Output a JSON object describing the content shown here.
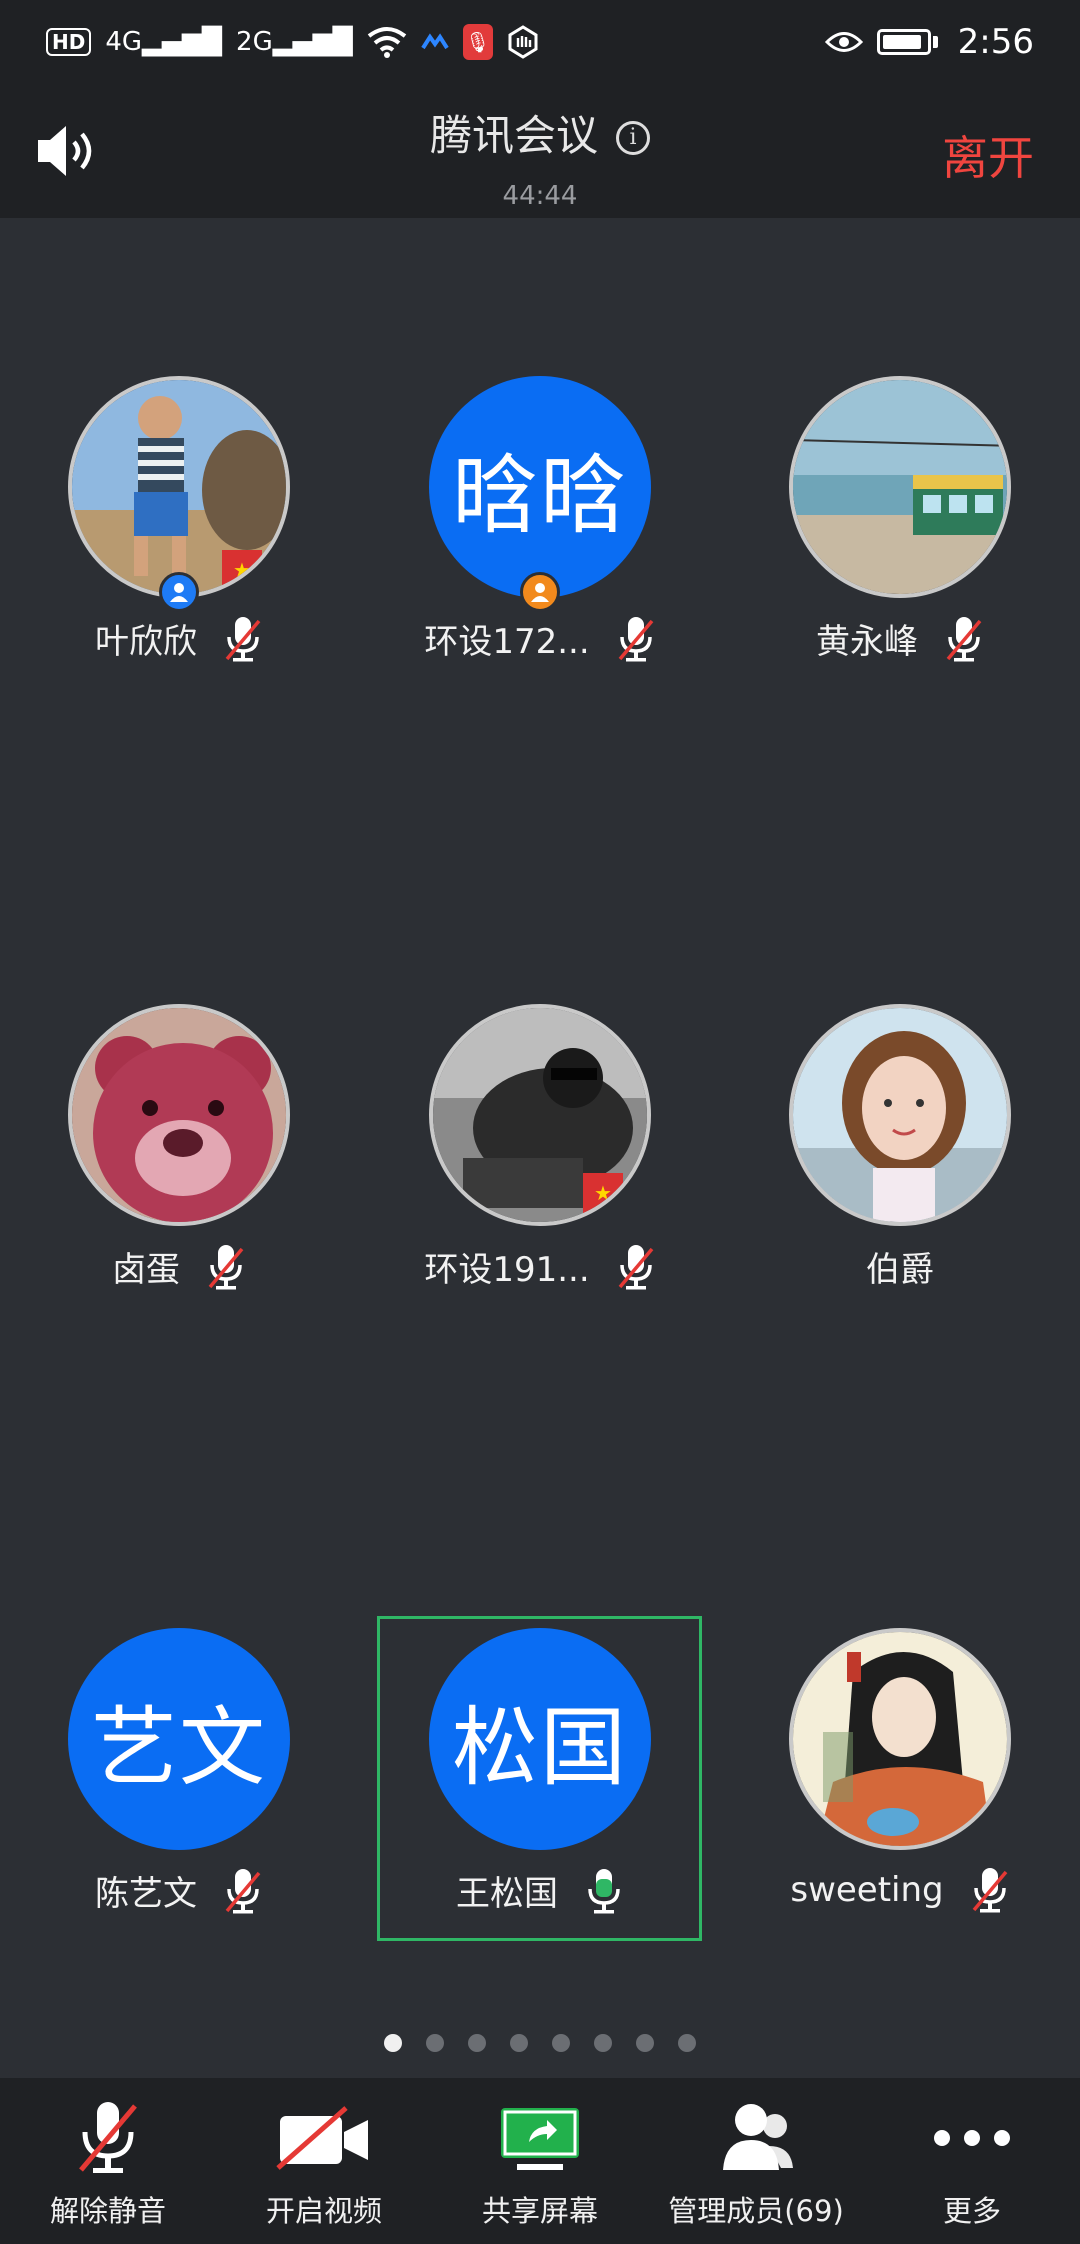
{
  "status_bar": {
    "network_1": "4G",
    "network_2": "2G",
    "time": "2:56"
  },
  "header": {
    "title": "腾讯会议",
    "timer": "44:44",
    "leave_label": "离开"
  },
  "participants": [
    {
      "name": "叶欣欣",
      "avatar_text": "",
      "photo": "boy",
      "muted": true,
      "badge": "host"
    },
    {
      "name": "环设172...",
      "avatar_text": "晗晗",
      "photo": "",
      "muted": true,
      "badge": "cohost"
    },
    {
      "name": "黄永峰",
      "avatar_text": "",
      "photo": "train",
      "muted": true,
      "badge": ""
    },
    {
      "name": "卤蛋",
      "avatar_text": "",
      "photo": "bear",
      "muted": true,
      "badge": ""
    },
    {
      "name": "环设191...",
      "avatar_text": "",
      "photo": "gorilla",
      "muted": true,
      "badge": ""
    },
    {
      "name": "伯爵",
      "avatar_text": "",
      "photo": "girl",
      "muted": false,
      "badge": ""
    },
    {
      "name": "陈艺文",
      "avatar_text": "艺文",
      "photo": "",
      "muted": true,
      "badge": ""
    },
    {
      "name": "王松国",
      "avatar_text": "松国",
      "photo": "",
      "muted": false,
      "speaking": true,
      "badge": ""
    },
    {
      "name": "sweeting",
      "avatar_text": "",
      "photo": "drawing",
      "muted": true,
      "badge": ""
    }
  ],
  "pager": {
    "pages": 8,
    "current": 1
  },
  "toolbar": {
    "unmute_label": "解除静音",
    "video_label": "开启视频",
    "share_label": "共享屏幕",
    "members_label": "管理成员(69)",
    "more_label": "更多"
  },
  "colors": {
    "accent_blue": "#0a6df3",
    "leave_red": "#f0453f",
    "speaking_green": "#2fb765",
    "share_green": "#22b14c"
  }
}
